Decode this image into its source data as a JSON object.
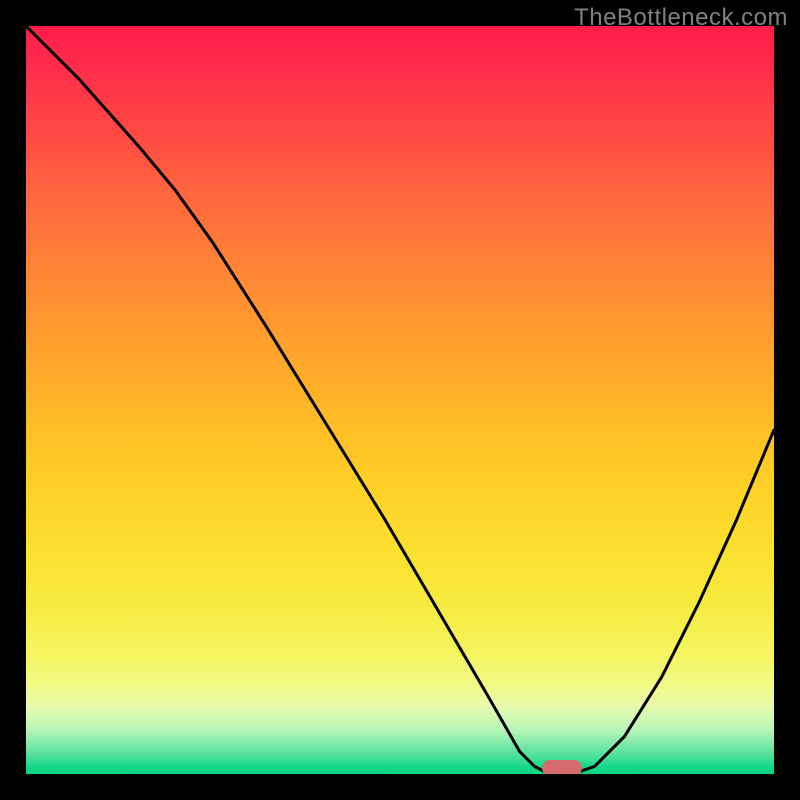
{
  "watermark": "TheBottleneck.com",
  "chart_data": {
    "type": "line",
    "title": "",
    "xlabel": "",
    "ylabel": "",
    "x_range": [
      0,
      100
    ],
    "y_range": [
      0,
      100
    ],
    "series": [
      {
        "name": "curve",
        "x": [
          0,
          7,
          15,
          20,
          25,
          32,
          40,
          48,
          55,
          62,
          66,
          68,
          70,
          73,
          76,
          80,
          85,
          90,
          95,
          100
        ],
        "y": [
          100,
          93,
          84,
          78,
          71,
          60,
          47,
          34,
          22,
          10,
          3,
          1,
          0,
          0,
          1,
          5,
          13,
          23,
          34,
          46
        ]
      }
    ],
    "marker": {
      "x": 71.7,
      "y": 0.8
    },
    "background_gradient": {
      "top_color": "#ff1c4a",
      "mid_color": "#fdd126",
      "bottom_color": "#07d682"
    }
  }
}
